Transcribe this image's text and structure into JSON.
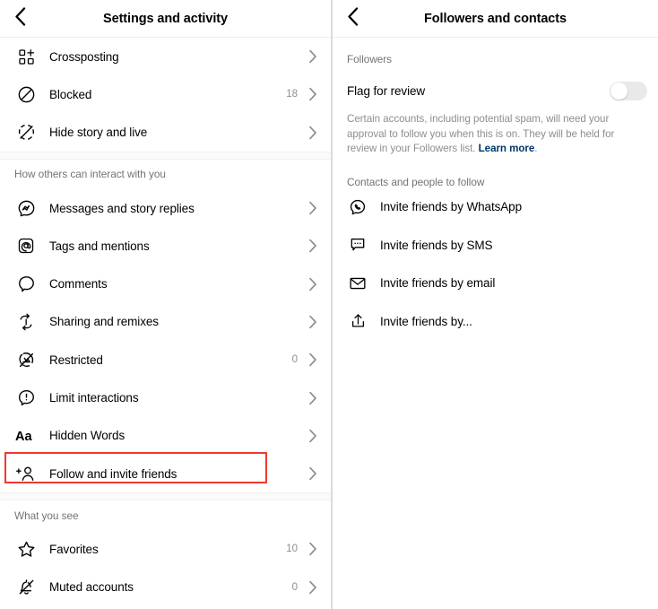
{
  "left_panel": {
    "header": {
      "title": "Settings and activity",
      "back_icon": "chevron-left-icon"
    },
    "groups": [
      {
        "section_label": "",
        "items": [
          {
            "label": "Crossposting",
            "icon": "crossposting-icon",
            "count": "",
            "chevron": "chevron-right-icon"
          },
          {
            "label": "Blocked",
            "icon": "block-circle-icon",
            "count": "18",
            "chevron": "chevron-right-icon"
          },
          {
            "label": "Hide story and live",
            "icon": "hide-story-icon",
            "count": "",
            "chevron": "chevron-right-icon"
          }
        ]
      },
      {
        "section_label": "How others can interact with you",
        "items": [
          {
            "label": "Messages and story replies",
            "icon": "messenger-icon",
            "count": "",
            "chevron": "chevron-right-icon"
          },
          {
            "label": "Tags and mentions",
            "icon": "at-mention-icon",
            "count": "",
            "chevron": "chevron-right-icon"
          },
          {
            "label": "Comments",
            "icon": "comment-bubble-icon",
            "count": "",
            "chevron": "chevron-right-icon"
          },
          {
            "label": "Sharing and remixes",
            "icon": "remix-loop-icon",
            "count": "",
            "chevron": "chevron-right-icon"
          },
          {
            "label": "Restricted",
            "icon": "restricted-icon",
            "count": "0",
            "chevron": "chevron-right-icon"
          },
          {
            "label": "Limit interactions",
            "icon": "limit-interactions-icon",
            "count": "",
            "chevron": "chevron-right-icon"
          },
          {
            "label": "Hidden Words",
            "icon": "hidden-words-aa-icon",
            "count": "",
            "chevron": "chevron-right-icon"
          },
          {
            "label": "Follow and invite friends",
            "icon": "add-person-icon",
            "count": "",
            "chevron": "chevron-right-icon"
          }
        ]
      },
      {
        "section_label": "What you see",
        "items": [
          {
            "label": "Favorites",
            "icon": "star-icon",
            "count": "10",
            "chevron": "chevron-right-icon"
          },
          {
            "label": "Muted accounts",
            "icon": "muted-bell-icon",
            "count": "0",
            "chevron": "chevron-right-icon"
          }
        ]
      }
    ]
  },
  "right_panel": {
    "header": {
      "title": "Followers and contacts",
      "back_icon": "chevron-left-icon"
    },
    "followers_section": {
      "label": "Followers",
      "flag_for_review": {
        "label": "Flag for review",
        "toggle_state": "off",
        "description_text": "Certain accounts, including potential spam, will need your approval to follow you when this is on. They will be held for review in your Followers list. ",
        "description_link": "Learn more",
        "description_tail": "."
      }
    },
    "contacts_section": {
      "label": "Contacts and people to follow",
      "items": [
        {
          "label": "Invite friends by WhatsApp",
          "icon": "whatsapp-icon"
        },
        {
          "label": "Invite friends by SMS",
          "icon": "sms-bubble-icon"
        },
        {
          "label": "Invite friends by email",
          "icon": "envelope-icon"
        },
        {
          "label": "Invite friends by...",
          "icon": "share-upload-icon"
        }
      ]
    }
  },
  "annotations": {
    "highlight_color": "#F0372C",
    "highlighted_items": [
      "Follow and invite friends",
      "Flag for review toggle"
    ]
  },
  "colors": {
    "text_primary": "#000000",
    "text_secondary": "#737373",
    "text_muted": "#8E8E8E",
    "link": "#00376B",
    "divider": "#EFEFEF",
    "band": "#FAFAFA",
    "toggle_off_track": "#E9E9EA",
    "accent_highlight": "#F0372C"
  }
}
